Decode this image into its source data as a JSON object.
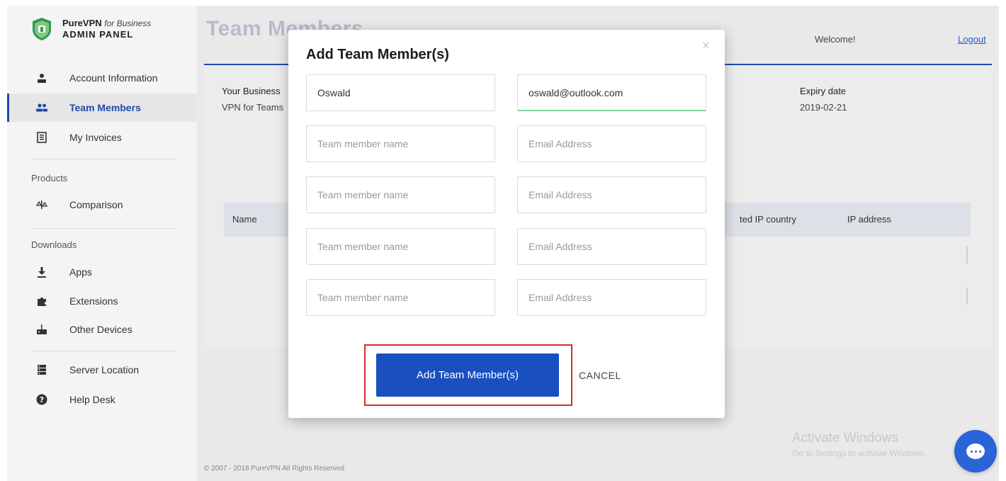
{
  "brand": {
    "name": "PureVPN",
    "for": "for Business",
    "subtitle": "ADMIN PANEL"
  },
  "sidebar": {
    "items": [
      {
        "label": "Account Information",
        "icon": "user-icon"
      },
      {
        "label": "Team Members",
        "icon": "team-icon",
        "active": true
      },
      {
        "label": "My Invoices",
        "icon": "invoice-icon"
      }
    ],
    "products_label": "Products",
    "products": [
      {
        "label": "Comparison",
        "icon": "scale-icon"
      }
    ],
    "downloads_label": "Downloads",
    "downloads": [
      {
        "label": "Apps",
        "icon": "download-icon"
      },
      {
        "label": "Extensions",
        "icon": "puzzle-icon"
      },
      {
        "label": "Other Devices",
        "icon": "router-icon"
      }
    ],
    "bottom": [
      {
        "label": "Server Location",
        "icon": "server-icon"
      },
      {
        "label": "Help Desk",
        "icon": "help-icon"
      }
    ]
  },
  "header": {
    "title": "Team Members",
    "welcome": "Welcome!",
    "logout": "Logout"
  },
  "info": {
    "business_label": "Your Business",
    "business_value": "VPN for Teams",
    "expiry_label": "Expiry date",
    "expiry_value": "2019-02-21"
  },
  "table": {
    "col_name": "Name",
    "col_ip_country": "ted IP country",
    "col_ip_address": "IP address"
  },
  "footer": {
    "copyright": "© 2007 - 2018 PureVPN All Rights Reserved"
  },
  "watermark": {
    "line1": "Activate Windows",
    "line2": "Go to Settings to activate Windows."
  },
  "modal": {
    "title": "Add Team Member(s)",
    "close": "×",
    "name_placeholder": "Team member name",
    "email_placeholder": "Email Address",
    "rows": [
      {
        "name": "Oswald",
        "email": "oswald@outlook.com"
      },
      {
        "name": "",
        "email": ""
      },
      {
        "name": "",
        "email": ""
      },
      {
        "name": "",
        "email": ""
      },
      {
        "name": "",
        "email": ""
      }
    ],
    "submit_label": "Add Team Member(s)",
    "cancel_label": "CANCEL"
  },
  "colors": {
    "accent": "#1a4fc0",
    "highlight": "#d52b2b",
    "title_muted": "#b7bccb"
  }
}
